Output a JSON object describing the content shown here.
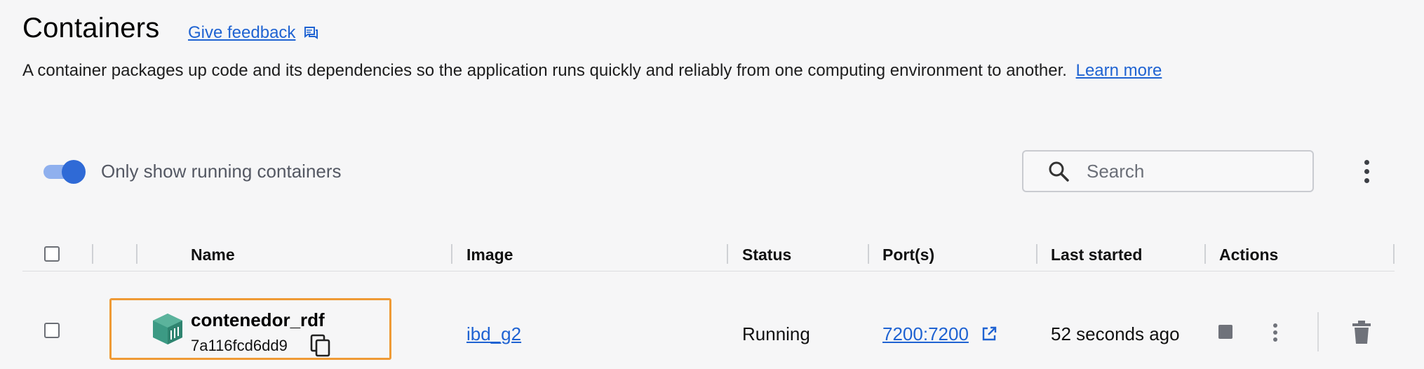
{
  "header": {
    "title": "Containers",
    "feedback_label": "Give feedback",
    "description": "A container packages up code and its dependencies so the application runs quickly and reliably from one computing environment to another.",
    "learn_more_label": "Learn more"
  },
  "toolbar": {
    "toggle_label": "Only show running containers",
    "toggle_on": true,
    "search_placeholder": "Search"
  },
  "table": {
    "columns": [
      "Name",
      "Image",
      "Status",
      "Port(s)",
      "Last started",
      "Actions"
    ],
    "rows": [
      {
        "name": "contenedor_rdf",
        "id": "7a116fcd6dd9",
        "image": "ibd_g2",
        "status": "Running",
        "ports": "7200:7200",
        "last_started": "52 seconds ago",
        "icon": "container-icon"
      }
    ]
  },
  "colors": {
    "accent": "#1f63d2",
    "toggle": "#2f6ad6",
    "highlight": "#ef9a35",
    "container_icon": "#3c9a84"
  }
}
